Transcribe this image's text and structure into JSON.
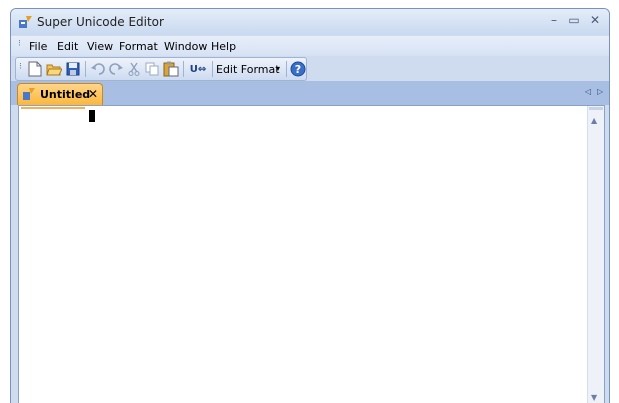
{
  "window": {
    "title": "Super Unicode Editor",
    "controls": {
      "minimize": "–",
      "maximize": "▭",
      "close": "✕"
    }
  },
  "menu": {
    "items": [
      "File",
      "Edit",
      "View",
      "Format",
      "Window",
      "Help"
    ]
  },
  "toolbar": {
    "edit_format_label": "Edit Format",
    "dropdown_arrow": "▾",
    "unicode_label": "U⇔"
  },
  "tabs": [
    {
      "label": "Untitled",
      "close": "✕"
    }
  ],
  "tab_nav": {
    "left": "◁",
    "right": "▷"
  },
  "scrollbar": {
    "up": "▲",
    "down": "▼"
  },
  "colors": {
    "accent_tab": "#fbb73b",
    "titlebar": "#cfdcef",
    "tab_strip": "#a8bfe3"
  }
}
